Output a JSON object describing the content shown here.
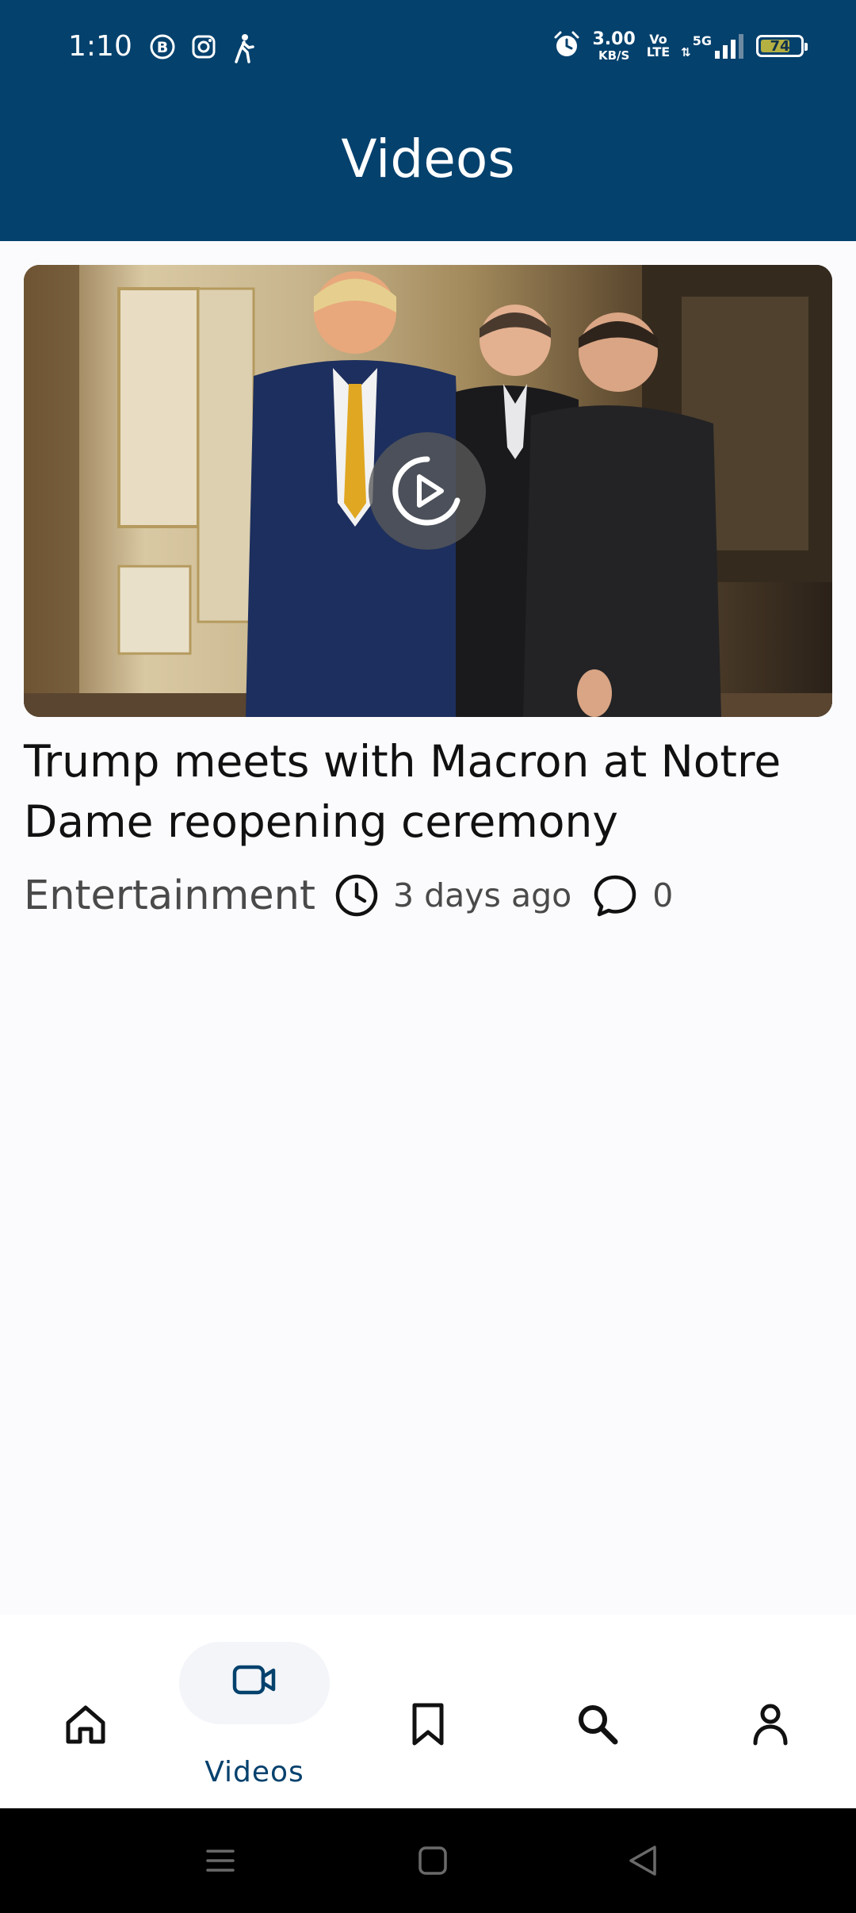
{
  "status_bar": {
    "time": "1:10",
    "net_speed": "3.00",
    "net_speed_unit": "KB/S",
    "volte_top": "Vo",
    "volte_bottom": "LTE",
    "network": "5G",
    "battery": "74",
    "battery_level": 0.74,
    "icons": [
      "b-circle-icon",
      "instagram-icon",
      "walking-icon",
      "alarm-icon",
      "signal-icon",
      "battery-icon"
    ]
  },
  "header": {
    "title": "Videos"
  },
  "video": {
    "title": "Trump meets with Macron at Notre Dame reopening ceremony",
    "category": "Entertainment",
    "time_ago": "3 days ago",
    "comments": "0"
  },
  "bottom_nav": {
    "items": [
      {
        "icon": "home-icon",
        "label": ""
      },
      {
        "icon": "video-camera-icon",
        "label": "Videos",
        "active": true
      },
      {
        "icon": "bookmark-icon",
        "label": ""
      },
      {
        "icon": "search-icon",
        "label": ""
      },
      {
        "icon": "profile-icon",
        "label": ""
      }
    ]
  },
  "colors": {
    "primary": "#04416d",
    "background": "#fbfbfe",
    "active_pill": "#f3f5f9"
  }
}
